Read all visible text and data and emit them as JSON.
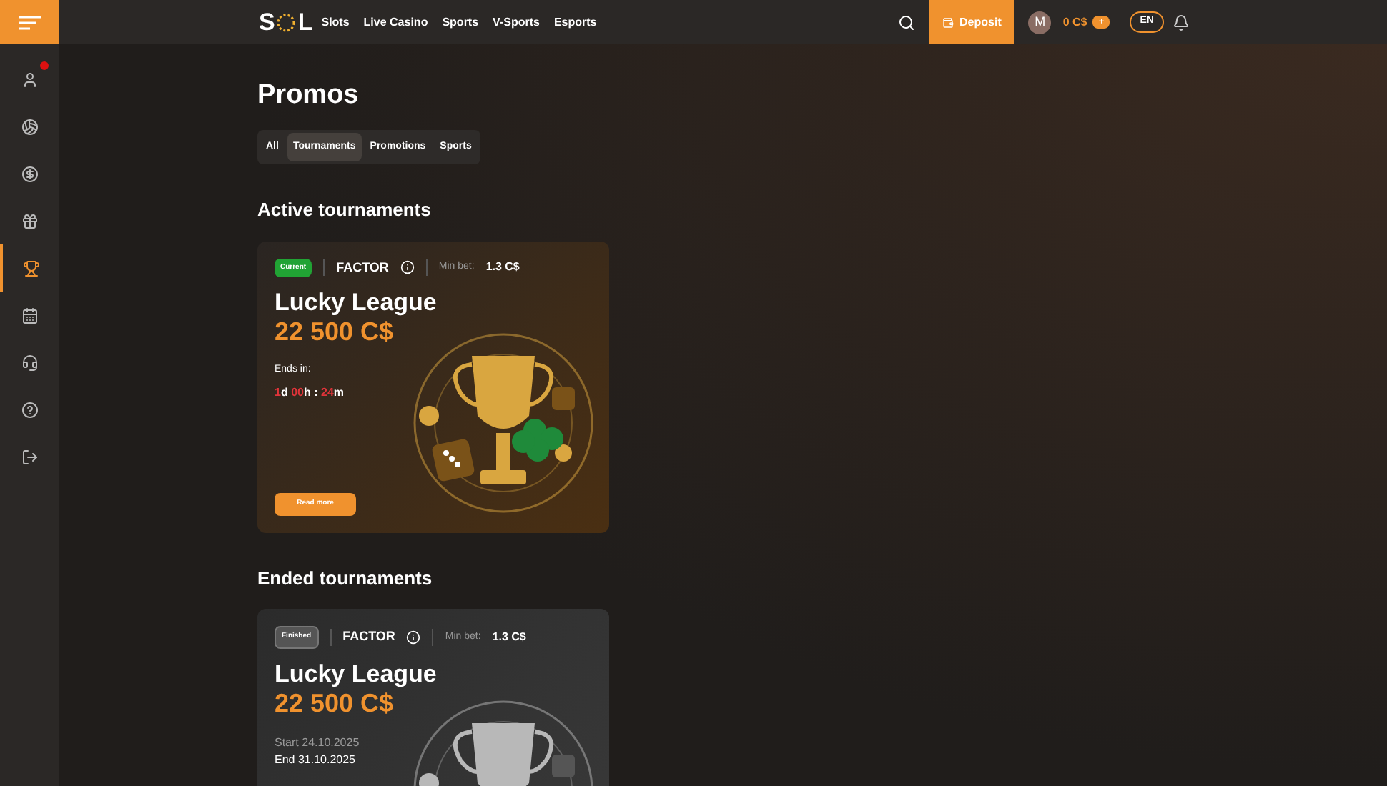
{
  "sidebar": {
    "items": [
      {
        "selected": false,
        "badge": true
      },
      {
        "selected": false,
        "badge": false
      },
      {
        "selected": false,
        "badge": false
      },
      {
        "selected": false,
        "badge": false
      },
      {
        "selected": true,
        "badge": false
      },
      {
        "selected": false,
        "badge": false
      },
      {
        "selected": false,
        "badge": false
      },
      {
        "selected": false,
        "badge": false
      },
      {
        "selected": false,
        "badge": false
      }
    ]
  },
  "header": {
    "logo": {
      "left": "S",
      "right": "L"
    },
    "nav": [
      "Slots",
      "Live Casino",
      "Sports",
      "V-Sports",
      "Esports"
    ],
    "deposit": "Deposit",
    "avatar": "M",
    "balance": "0 C$",
    "add": "+",
    "language": "EN"
  },
  "page": {
    "title": "Promos",
    "tabs": [
      {
        "label": "All",
        "selected": false
      },
      {
        "label": "Tournaments",
        "selected": true
      },
      {
        "label": "Promotions",
        "selected": false
      },
      {
        "label": "Sports",
        "selected": false
      }
    ]
  },
  "sections": [
    {
      "title": "Active tournaments",
      "card": {
        "kind": "current",
        "status": "Current",
        "factor": "FACTOR",
        "min_bet_label": "Min bet:",
        "min_bet": "1.3 C$",
        "name": "Lucky League",
        "prize": "22 500 C$",
        "ends_label": "Ends in:",
        "countdown": [
          {
            "kind": "num",
            "text": "1"
          },
          {
            "kind": "unit",
            "text": "d"
          },
          {
            "kind": "num",
            "text": "00"
          },
          {
            "kind": "unit",
            "text": "h :"
          },
          {
            "kind": "num",
            "text": "24"
          },
          {
            "kind": "unit",
            "text": "m"
          }
        ],
        "button": "Read more"
      }
    },
    {
      "title": "Ended tournaments",
      "card": {
        "kind": "finished",
        "status": "Finished",
        "factor": "FACTOR",
        "min_bet_label": "Min bet:",
        "min_bet": "1.3 C$",
        "name": "Lucky League",
        "prize": "22 500 C$",
        "start": "Start 24.10.2025",
        "end": "End 31.10.2025"
      }
    }
  ]
}
